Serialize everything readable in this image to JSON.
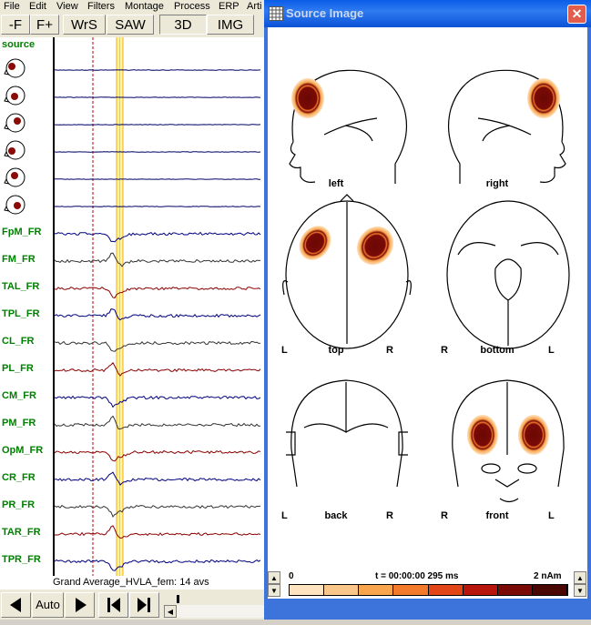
{
  "menu": [
    "File",
    "Edit",
    "View",
    "Filters",
    "Montage",
    "Process",
    "ERP",
    "Arti"
  ],
  "toolbar": {
    "b1": "-F",
    "b2": "F+",
    "b3": "WrS",
    "b4": "SAW",
    "b5": "3D",
    "b6": "IMG"
  },
  "source_label": "source",
  "channels": [
    "FpM_FR",
    "FM_FR",
    "TAL_FR",
    "TPL_FR",
    "CL_FR",
    "PL_FR",
    "CM_FR",
    "PM_FR",
    "OpM_FR",
    "CR_FR",
    "PR_FR",
    "TAR_FR",
    "TPR_FR"
  ],
  "status": "Grand Average_HVLA_fem: 14 avs",
  "bottom": {
    "auto": "Auto"
  },
  "window": {
    "title": "Source Image",
    "close": "✕",
    "views": {
      "left": {
        "label": "left"
      },
      "right": {
        "label": "right"
      },
      "top": {
        "label": "top",
        "l": "L",
        "r": "R"
      },
      "bottom": {
        "label": "bottom",
        "l": "R",
        "r": "L"
      },
      "back": {
        "label": "back",
        "l": "L",
        "r": "R"
      },
      "front": {
        "label": "front",
        "l": "R",
        "r": "L"
      }
    },
    "scale": {
      "min": "0",
      "time": "t = 00:00:00  295 ms",
      "max": "2 nAm"
    },
    "colors": [
      "#fde3c0",
      "#fbc68a",
      "#f9a54e",
      "#f27a2a",
      "#e24618",
      "#b8160c",
      "#7a0a06",
      "#4a0602"
    ]
  }
}
